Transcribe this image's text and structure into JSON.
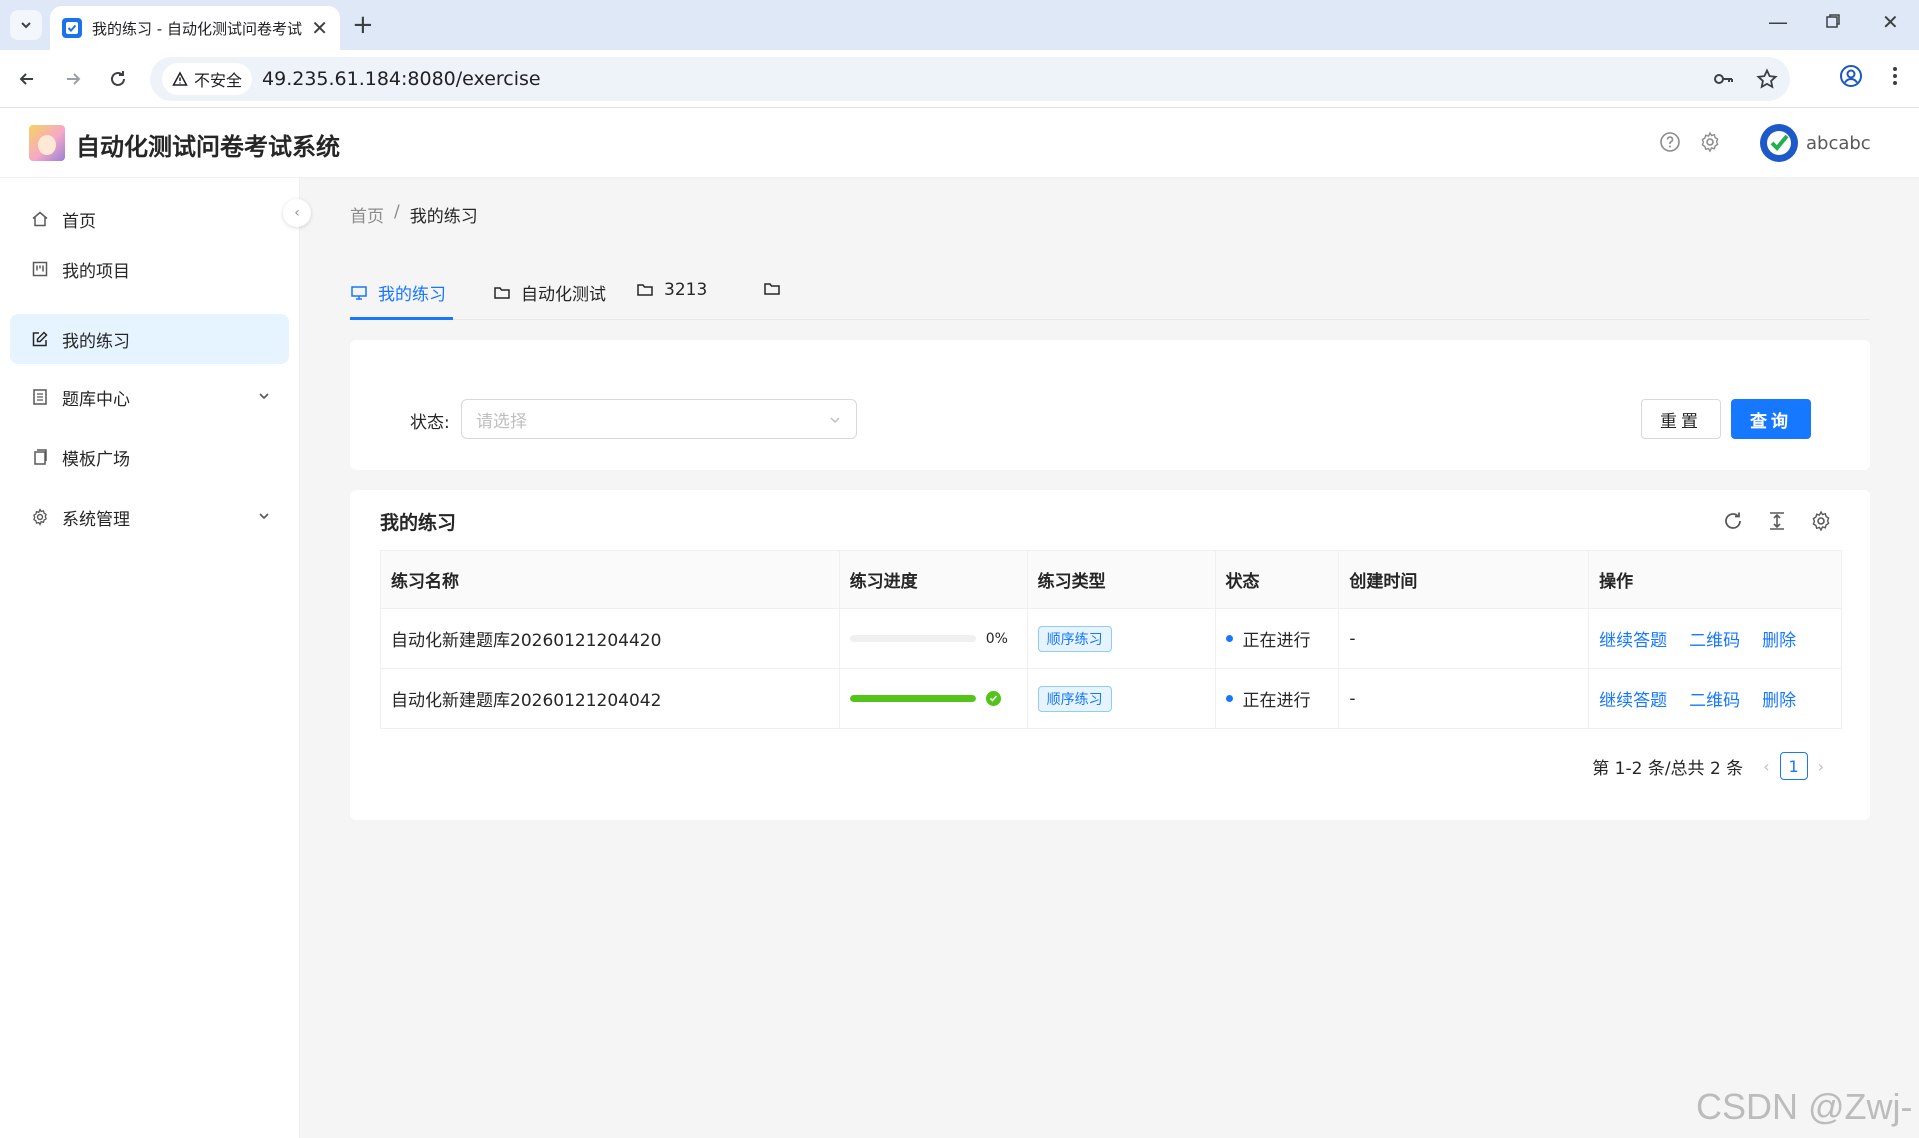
{
  "browser": {
    "tab_title": "我的练习 - 自动化测试问卷考试",
    "security_label": "不安全",
    "url": "49.235.61.184:8080/exercise"
  },
  "header": {
    "app_title": "自动化测试问卷考试系统",
    "username": "abcabc"
  },
  "sidebar": {
    "items": [
      {
        "label": "首页",
        "icon": "home-icon"
      },
      {
        "label": "我的项目",
        "icon": "project-icon"
      },
      {
        "label": "我的练习",
        "icon": "edit-icon"
      },
      {
        "label": "题库中心",
        "icon": "book-icon"
      },
      {
        "label": "模板广场",
        "icon": "copy-icon"
      },
      {
        "label": "系统管理",
        "icon": "gear-icon"
      }
    ]
  },
  "breadcrumb": {
    "home": "首页",
    "sep": "/",
    "current": "我的练习"
  },
  "page_tabs": [
    {
      "label": "我的练习",
      "icon": "desktop-icon"
    },
    {
      "label": "自动化测试",
      "icon": "folder-icon"
    },
    {
      "label": "3213",
      "icon": "folder-icon"
    },
    {
      "label": "",
      "icon": "folder-icon"
    }
  ],
  "filter": {
    "status_label": "状态:",
    "status_placeholder": "请选择",
    "reset_label": "重置",
    "query_label": "查询"
  },
  "table": {
    "title": "我的练习",
    "columns": [
      "练习名称",
      "练习进度",
      "练习类型",
      "状态",
      "创建时间",
      "操作"
    ],
    "rows": [
      {
        "name": "自动化新建题库20260121204420",
        "progress": 0,
        "progress_text": "0%",
        "type": "顺序练习",
        "status": "正在进行",
        "created": "-"
      },
      {
        "name": "自动化新建题库20260121204042",
        "progress": 100,
        "progress_text": "",
        "type": "顺序练习",
        "status": "正在进行",
        "created": "-"
      }
    ],
    "actions": [
      "继续答题",
      "二维码",
      "删除"
    ]
  },
  "pagination": {
    "summary": "第 1-2 条/总共 2 条",
    "current_page": "1"
  },
  "watermark": "CSDN @Zwj-c"
}
